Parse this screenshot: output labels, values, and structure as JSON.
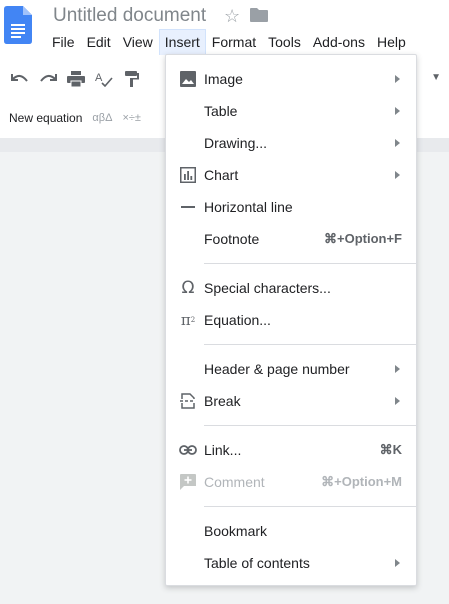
{
  "doc": {
    "title": "Untitled document"
  },
  "menubar": [
    "File",
    "Edit",
    "View",
    "Insert",
    "Format",
    "Tools",
    "Add-ons",
    "Help"
  ],
  "equation_bar": {
    "new_equation": "New equation",
    "greek": "αβΔ",
    "ops": "×÷±"
  },
  "insert_menu": {
    "items": [
      {
        "label": "Image",
        "submenu": true,
        "icon": "image-icon"
      },
      {
        "label": "Table",
        "submenu": true
      },
      {
        "label": "Drawing...",
        "submenu": true
      },
      {
        "label": "Chart",
        "submenu": true,
        "icon": "chart-icon"
      },
      {
        "label": "Horizontal line",
        "icon": "horizontal-line-icon"
      },
      {
        "label": "Footnote",
        "shortcut": "⌘+Option+F"
      },
      {
        "label": "Special characters...",
        "icon": "omega-icon"
      },
      {
        "label": "Equation...",
        "icon": "pi-icon"
      },
      {
        "label": "Header & page number",
        "submenu": true
      },
      {
        "label": "Break",
        "submenu": true,
        "icon": "page-break-icon"
      },
      {
        "label": "Link...",
        "shortcut": "⌘K",
        "icon": "link-icon"
      },
      {
        "label": "Comment",
        "shortcut": "⌘+Option+M",
        "icon": "add-comment-icon",
        "disabled": true
      },
      {
        "label": "Bookmark"
      },
      {
        "label": "Table of contents",
        "submenu": true
      }
    ]
  },
  "colors": {
    "accent": "#1a73e8",
    "menu_active_bg": "#e8f0fe",
    "disabled_text": "#b1b5b9"
  }
}
